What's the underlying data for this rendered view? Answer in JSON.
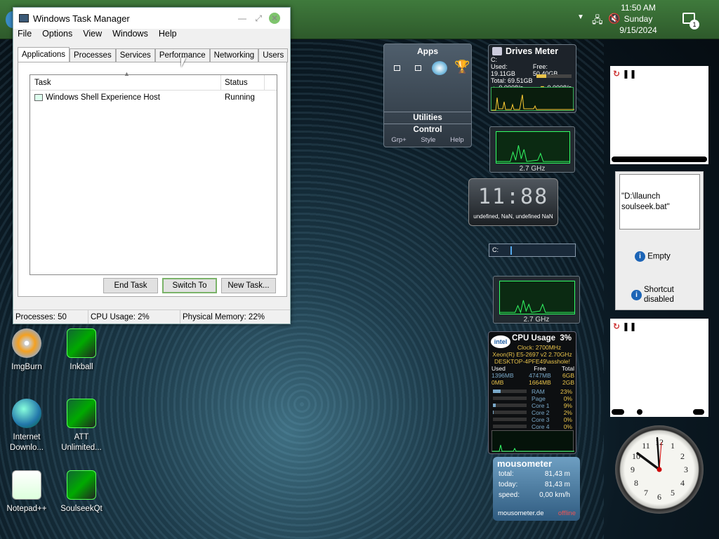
{
  "taskbar": {
    "time": "11:50 AM",
    "day": "Sunday",
    "date": "9/15/2024",
    "notification_count": "1"
  },
  "desktop": {
    "icons": [
      {
        "label": "ImgBurn"
      },
      {
        "label": "Inkball"
      },
      {
        "label": "Internet Downlo..."
      },
      {
        "label": "ATT Unlimited..."
      },
      {
        "label": "Notepad++"
      },
      {
        "label": "SoulseekQt"
      }
    ]
  },
  "task_manager": {
    "title": "Windows Task Manager",
    "menu": [
      "File",
      "Options",
      "View",
      "Windows",
      "Help"
    ],
    "tabs": [
      "Applications",
      "Processes",
      "Services",
      "Performance",
      "Networking",
      "Users"
    ],
    "active_tab": "Applications",
    "columns": [
      "Task",
      "Status"
    ],
    "rows": [
      {
        "task": "Windows Shell Experience Host",
        "status": "Running"
      }
    ],
    "buttons": {
      "end_task": "End Task",
      "switch_to": "Switch To",
      "new_task": "New Task..."
    },
    "status": {
      "processes": "Processes: 50",
      "cpu": "CPU Usage: 2%",
      "memory": "Physical Memory: 22%"
    }
  },
  "gadgets": {
    "apps": {
      "title": "Apps",
      "utilities": "Utilities",
      "control": "Control",
      "footer": [
        "Grp+",
        "Style",
        "Help"
      ]
    },
    "drives": {
      "title": "Drives Meter",
      "drive": "C:",
      "used": "Used: 19.11GB",
      "free": "Free: 50.40GB",
      "total": "Total: 69.51GB",
      "read": "0.0008/s",
      "write": "0.0008/s"
    },
    "cpu_meter1": {
      "ghz": "2.7 GHz"
    },
    "cpu_meter2": {
      "ghz": "2.7 GHz"
    },
    "digital_clock": {
      "digits": "11:88",
      "subtitle": "undefined, NaN, undefined NaN"
    },
    "drive_bar": {
      "label": "C:"
    },
    "intel": {
      "title": "CPU Usage",
      "percent": "3%",
      "clock": "Clock: 2700MHz",
      "cpu_name": "Xeon(R) E5-2697 v2 2.70GHz",
      "host": "DESKTOP-4PFE49\\asshole!",
      "mem_headers": [
        "Used",
        "Free",
        "Total"
      ],
      "mem_row1": [
        "1396MB",
        "4747MB",
        "6GB"
      ],
      "mem_row2": [
        "0MB",
        "1664MB",
        "2GB"
      ],
      "rows": [
        {
          "label": "RAM",
          "value": "23%",
          "level": 0.23
        },
        {
          "label": "Page",
          "value": "0%",
          "level": 0
        },
        {
          "label": "Core 1",
          "value": "9%",
          "level": 0.09
        },
        {
          "label": "Core 2",
          "value": "2%",
          "level": 0.02
        },
        {
          "label": "Core 3",
          "value": "0%",
          "level": 0
        },
        {
          "label": "Core 4",
          "value": "0%",
          "level": 0
        }
      ]
    },
    "mousometer": {
      "title": "mousometer",
      "total_label": "total:",
      "total": "81,43 m",
      "today_label": "today:",
      "today": "81,43 m",
      "speed_label": "speed:",
      "speed": "0,00 km/h",
      "footer": "mousometer.de",
      "status": "offline"
    },
    "launcher": {
      "path": "\"D:\\llaunch soulseek.bat\"",
      "empty": "Empty",
      "shortcut": "Shortcut disabled"
    }
  },
  "colors": {
    "taskbar": "#336b31",
    "accent_green": "#7bb36a",
    "graph_green": "#33ff66"
  }
}
